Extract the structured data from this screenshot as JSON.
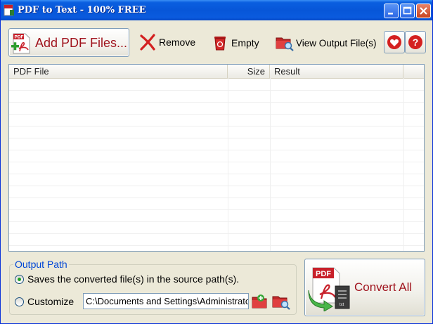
{
  "window": {
    "title": "PDF to Text - 100% FREE"
  },
  "toolbar": {
    "add_label": "Add PDF Files...",
    "remove_label": "Remove",
    "empty_label": "Empty",
    "view_output_label": "View Output File(s)"
  },
  "file_list": {
    "columns": [
      "PDF File",
      "Size",
      "Result"
    ],
    "rows": []
  },
  "output": {
    "group_label": "Output Path",
    "source_option_label": "Saves the converted file(s) in the source path(s).",
    "customize_label": "Customize",
    "path_value": "C:\\Documents and Settings\\Administrator",
    "selected": "source"
  },
  "convert": {
    "label": "Convert All",
    "icon_badge": "PDF",
    "icon_sub": "txt"
  },
  "icons": {
    "app": "pdf-app-icon",
    "add": "pdf-add-icon",
    "remove": "red-x-icon",
    "empty": "recycle-bin-icon",
    "view": "folder-search-icon",
    "heart": "heart-icon",
    "help": "help-icon"
  },
  "colors": {
    "accent_text": "#a0141e",
    "group_title": "#0046d5",
    "title_bar": "#0756d8"
  }
}
